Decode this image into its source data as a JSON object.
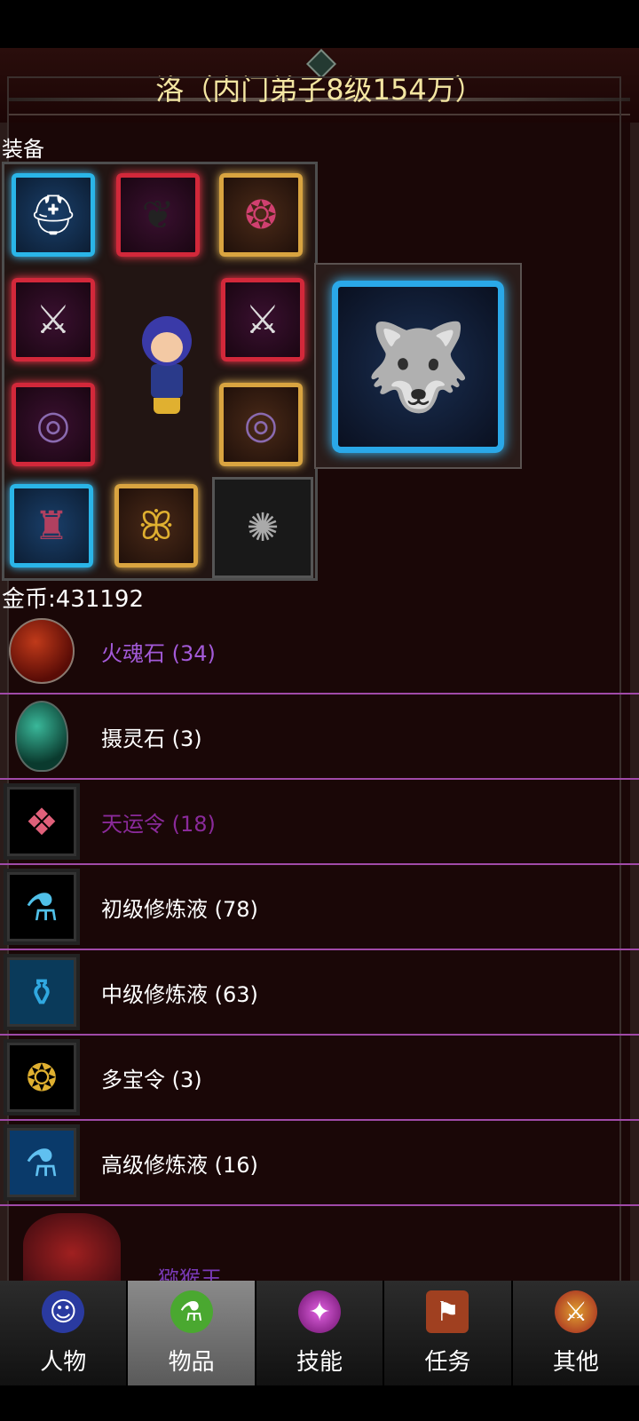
{
  "header": {
    "title": "洛（内门弟子8级154万）"
  },
  "equipment": {
    "section_label": "装备",
    "slots": [
      {
        "name": "helmet-slot",
        "icon": "helmet-icon"
      },
      {
        "name": "wings-slot",
        "icon": "wings-icon"
      },
      {
        "name": "necklace-slot",
        "icon": "necklace-icon"
      },
      {
        "name": "weapon-left-slot",
        "icon": "sword-icon"
      },
      {
        "name": "weapon-right-slot",
        "icon": "sword-icon"
      },
      {
        "name": "bracer-left-slot",
        "icon": "bracer-icon"
      },
      {
        "name": "bracer-right-slot",
        "icon": "bracer-icon"
      },
      {
        "name": "armor-slot",
        "icon": "armor-icon"
      },
      {
        "name": "boots-slot",
        "icon": "boots-icon"
      },
      {
        "name": "accessory-slot",
        "icon": "orb-accessory-icon"
      }
    ],
    "mount_icon": "beast-mount-icon"
  },
  "gold": {
    "label": "金币:431192"
  },
  "items": [
    {
      "label": "火魂石 (34)",
      "color": "#a35ad8",
      "icon": "fire-soul-stone-icon"
    },
    {
      "label": "摄灵石 (3)",
      "color": "#ffffff",
      "icon": "spirit-stone-icon"
    },
    {
      "label": "天运令 (18)",
      "color": "#8a2a9a",
      "icon": "heaven-token-icon"
    },
    {
      "label": "初级修炼液 (78)",
      "color": "#ffffff",
      "icon": "potion-basic-icon"
    },
    {
      "label": "中级修炼液 (63)",
      "color": "#ffffff",
      "icon": "potion-mid-icon"
    },
    {
      "label": "多宝令 (3)",
      "color": "#ffffff",
      "icon": "treasure-token-icon"
    },
    {
      "label": "高级修炼液 (16)",
      "color": "#ffffff",
      "icon": "potion-high-icon"
    }
  ],
  "partial_item": {
    "label": "猕猴王",
    "icon": "monkey-king-icon"
  },
  "tabs": [
    {
      "label": "人物",
      "icon": "character-icon",
      "active": false
    },
    {
      "label": "物品",
      "icon": "items-icon",
      "active": true
    },
    {
      "label": "技能",
      "icon": "skills-icon",
      "active": false
    },
    {
      "label": "任务",
      "icon": "quest-icon",
      "active": false
    },
    {
      "label": "其他",
      "icon": "other-icon",
      "active": false
    }
  ]
}
